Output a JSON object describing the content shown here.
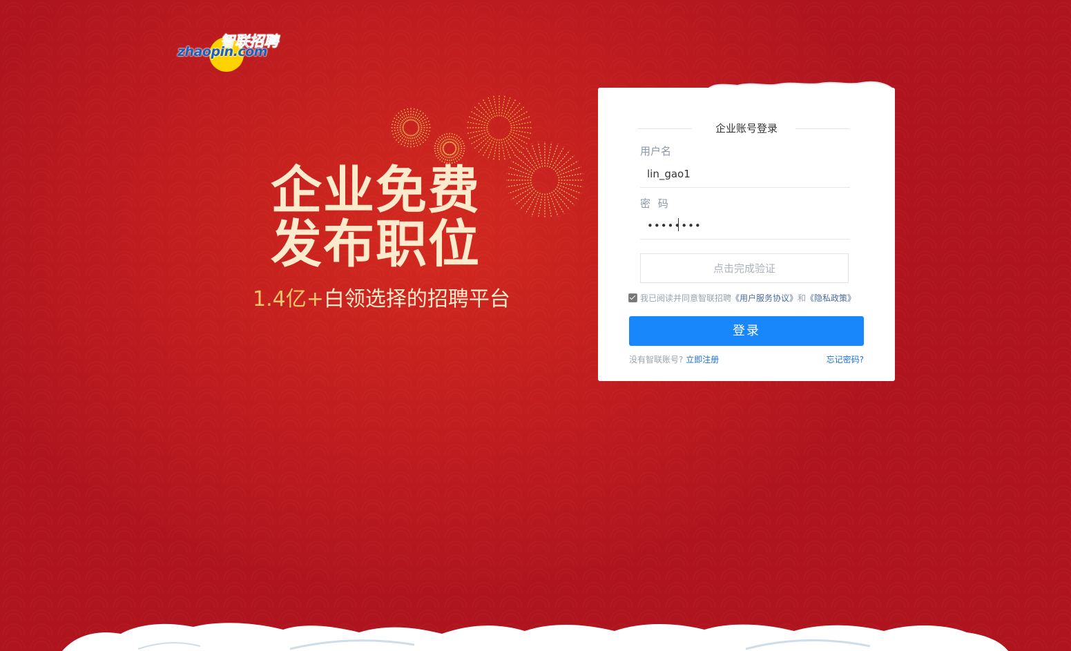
{
  "brand": {
    "logo_cn": "智联招聘",
    "logo_en": "zhaopin.com"
  },
  "hero": {
    "line1": "企业免费",
    "line2": "发布职位",
    "subtitle_prefix": "1.4亿+",
    "subtitle_rest": "白领选择的招聘平台"
  },
  "login": {
    "title": "企业账号登录",
    "username_label": "用户名",
    "username_value": "lin_gao1",
    "password_label": "密 码",
    "password_value": "••••••••",
    "verify_label": "点击完成验证",
    "agree_text": "我已阅读并同意智联招聘",
    "agree_link1": "《用户服务协议》",
    "agree_and": "和",
    "agree_link2": "《隐私政策》",
    "agreed": true,
    "submit_label": "登录",
    "no_account_text": "没有智联账号?",
    "register_link": "立即注册",
    "forgot_link": "忘记密码?"
  },
  "colors": {
    "background": "#c41f1f",
    "accent_button": "#1787fb",
    "hero_text": "#fbeacb",
    "hero_highlight": "#f7c46c"
  }
}
